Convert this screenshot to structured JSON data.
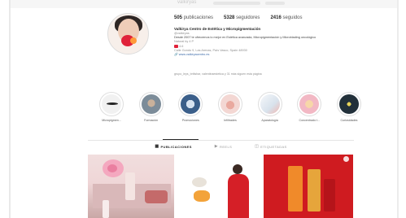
{
  "top": {
    "username_partial": "valkiryas"
  },
  "stats": {
    "posts_count": "505",
    "posts_label": "publicaciones",
    "followers_count": "5328",
    "followers_label": "seguidores",
    "following_count": "2416",
    "following_label": "seguidos"
  },
  "profile": {
    "name": "Valkirya Centro de Estética y Micropigmentación",
    "handle": "@valkiryas",
    "bio1": "Desde 2007 te ofrecemos lo mejor en Estética avanzada, Micropigmentación y Microblading oncológico",
    "bio2": "Natural by 4 P",
    "bio3": "4.6",
    "address": "Calle Gondo 9, Las Arenas, País Vasco, Spain 48930",
    "website": "www.valkiryacentro.es",
    "followed_by": "grupo_leys_britishar, valentinaestetica y 31 más siguen esta página"
  },
  "highlights": [
    {
      "label": "Micropigmen...",
      "color": "#eeeeee"
    },
    {
      "label": "Formación",
      "color": "#7c8c99"
    },
    {
      "label": "Promociones",
      "color": "#3b5f8a"
    },
    {
      "label": "Infiltrades",
      "color": "#f3c7c3"
    },
    {
      "label": "Aparatología",
      "color": "#e2e8ee"
    },
    {
      "label": "Concentrado t...",
      "color": "#f2b8c4"
    },
    {
      "label": "Curiosidades",
      "color": "#22303a"
    }
  ],
  "tabs": {
    "posts": "PUBLICACIONES",
    "reels": "REELS",
    "tagged": "ETIQUETADAS"
  },
  "colors": {
    "brand_red": "#cf1b20",
    "text": "#262626",
    "secondary": "#8e8e8e"
  }
}
